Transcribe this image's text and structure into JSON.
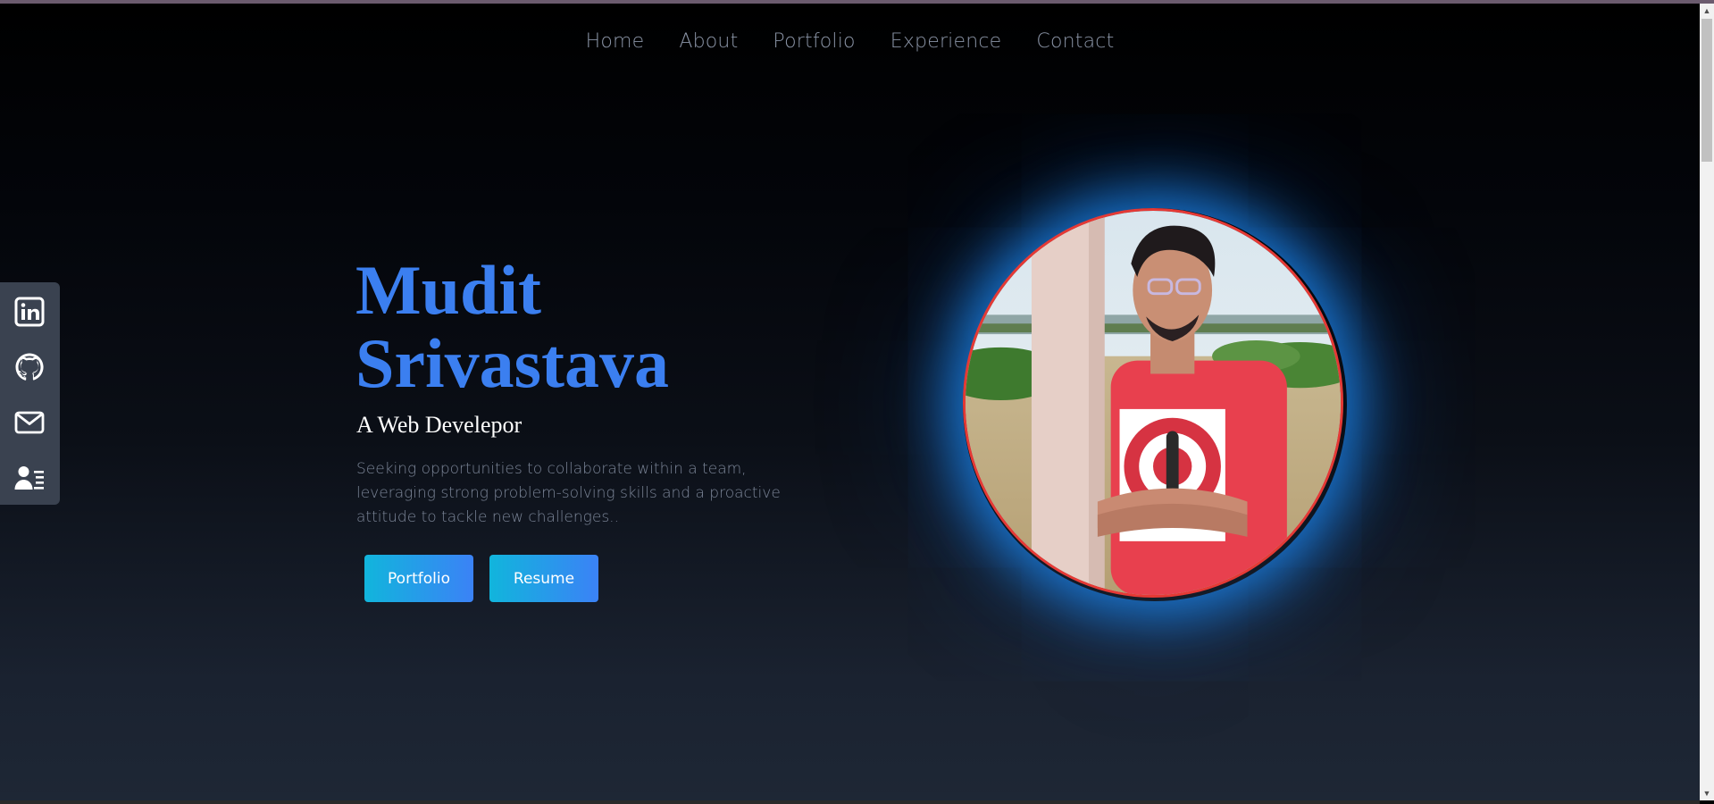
{
  "nav": {
    "items": [
      {
        "label": "Home"
      },
      {
        "label": "About"
      },
      {
        "label": "Portfolio"
      },
      {
        "label": "Experience"
      },
      {
        "label": "Contact"
      }
    ]
  },
  "social": {
    "items": [
      {
        "icon": "linkedin-icon"
      },
      {
        "icon": "github-icon"
      },
      {
        "icon": "mail-icon"
      },
      {
        "icon": "resume-icon"
      }
    ]
  },
  "hero": {
    "name_line1": "Mudit",
    "name_line2": "Srivastava",
    "role": "A Web Develepor",
    "description": "Seeking opportunities to collaborate within a team, leveraging strong problem-solving skills and a proactive attitude to tackle new challenges..",
    "buttons": {
      "portfolio": "Portfolio",
      "resume": "Resume"
    }
  },
  "colors": {
    "accent": "#3b7ff0",
    "button_gradient_start": "#11b5dc",
    "button_gradient_end": "#3b82f6",
    "avatar_border": "#e53935",
    "glow": "#1e90ff",
    "sidebar_bg": "#3a4250"
  }
}
